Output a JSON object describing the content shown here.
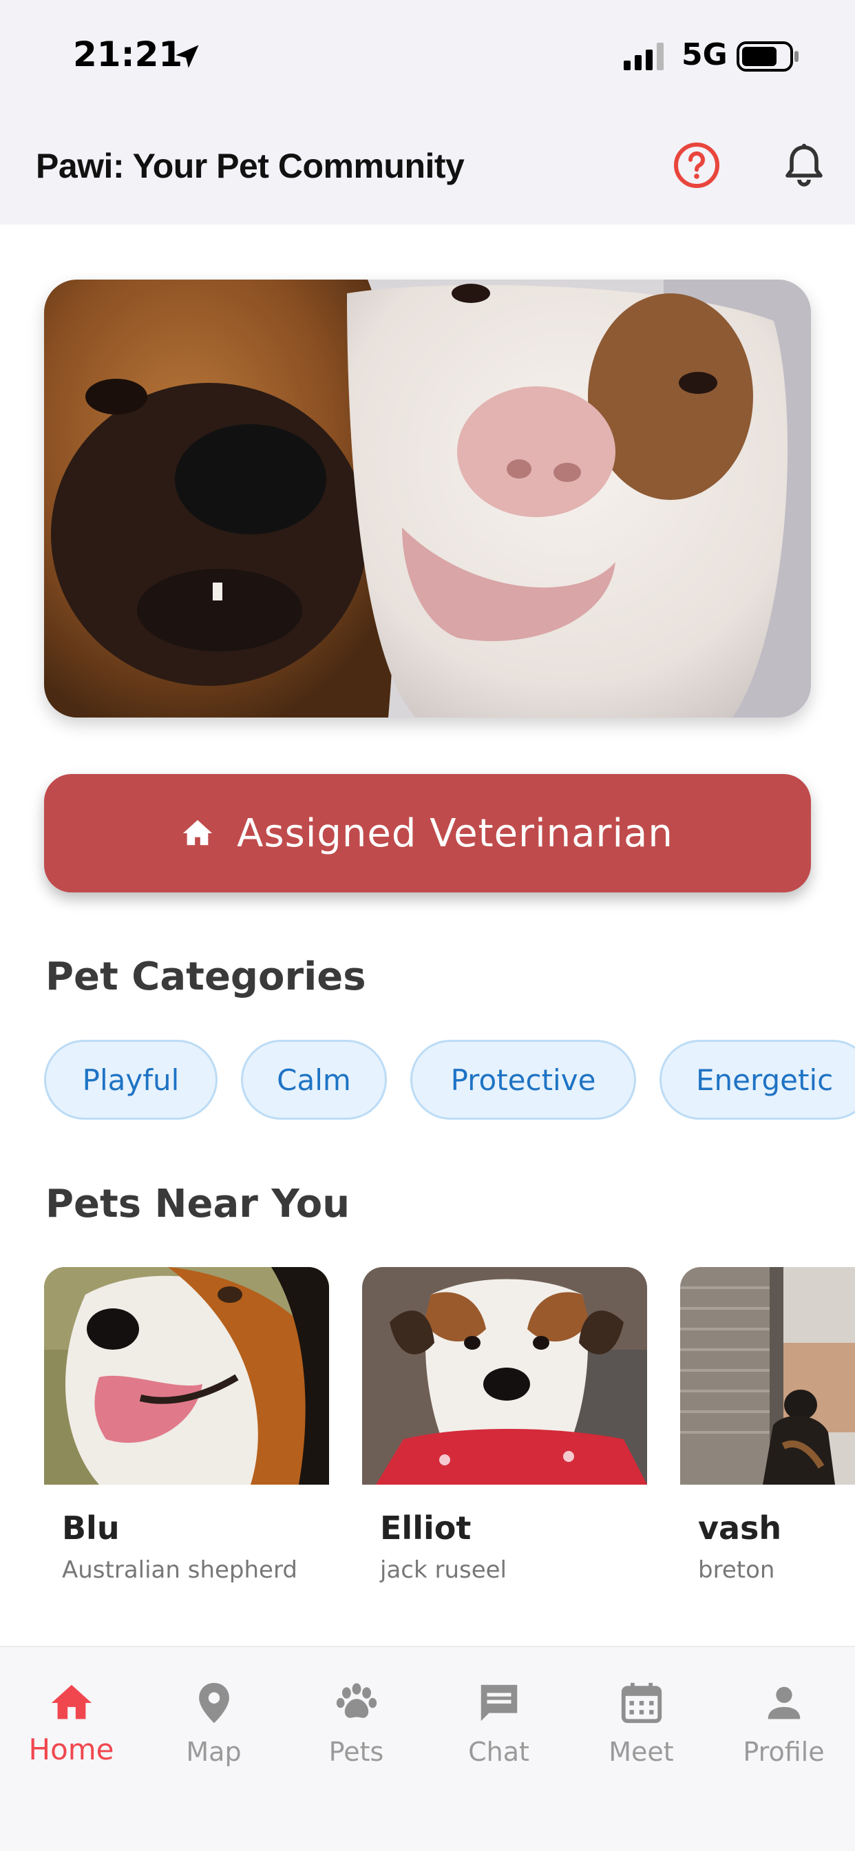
{
  "status_bar": {
    "time": "21:21",
    "network": "5G"
  },
  "header": {
    "title": "Pawi: Your Pet Community",
    "help_icon": "help-circle-icon",
    "bell_icon": "bell-icon"
  },
  "hero": {
    "image": "two dogs selfie photo"
  },
  "vet_button": {
    "label": "Assigned Veterinarian",
    "icon": "home-icon"
  },
  "categories": {
    "title": "Pet Categories",
    "items": [
      "Playful",
      "Calm",
      "Protective",
      "Energetic"
    ]
  },
  "nearby": {
    "title": "Pets Near You",
    "pets": [
      {
        "name": "Blu",
        "breed": "Australian shepherd"
      },
      {
        "name": "Elliot",
        "breed": "jack ruseel"
      },
      {
        "name": "vash",
        "breed": "breton"
      }
    ]
  },
  "nav": {
    "items": [
      {
        "label": "Home",
        "icon": "home-icon",
        "active": true
      },
      {
        "label": "Map",
        "icon": "map-pin-icon",
        "active": false
      },
      {
        "label": "Pets",
        "icon": "paw-icon",
        "active": false
      },
      {
        "label": "Chat",
        "icon": "chat-icon",
        "active": false
      },
      {
        "label": "Meet",
        "icon": "calendar-icon",
        "active": false
      },
      {
        "label": "Profile",
        "icon": "person-icon",
        "active": false
      }
    ]
  },
  "colors": {
    "accent": "#f0474f",
    "vet_button": "#c04b4c",
    "chip_bg": "#e6f2fd",
    "chip_text": "#1e73c4"
  }
}
